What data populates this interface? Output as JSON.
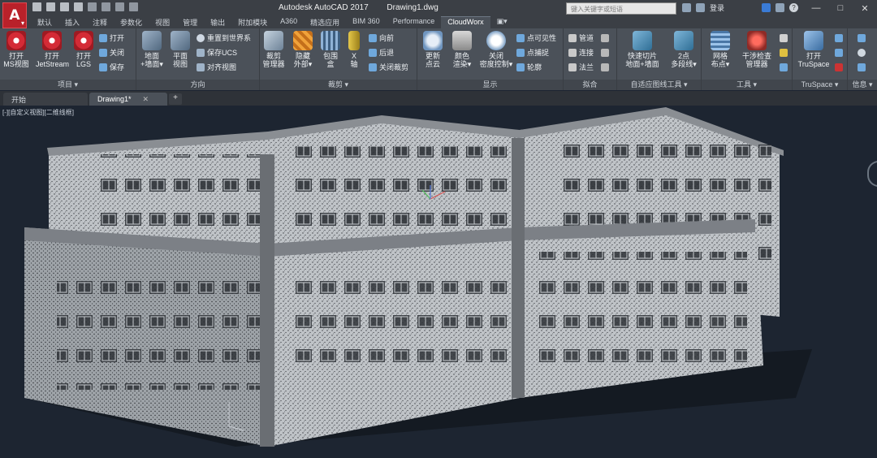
{
  "app": {
    "logo": "A",
    "logo_sub": "▾",
    "title": "Autodesk AutoCAD 2017",
    "file": "Drawing1.dwg"
  },
  "search": {
    "placeholder": "键入关键字或短语"
  },
  "user": {
    "login": "登录",
    "help": "?"
  },
  "window_controls": {
    "minimize": "—",
    "maximize": "□",
    "close": "✕"
  },
  "ribbon_tabs": [
    "默认",
    "插入",
    "注释",
    "参数化",
    "视图",
    "管理",
    "输出",
    "附加模块",
    "A360",
    "精选应用",
    "BIM 360",
    "Performance",
    "CloudWorx",
    "▣▾"
  ],
  "active_tab": "CloudWorx",
  "panels": {
    "project": {
      "title": "项目 ▾",
      "buttons": [
        "打开\nMS视图",
        "打开\nJetStream",
        "打开\nLGS"
      ],
      "small": [
        "打开",
        "关闭",
        "保存"
      ]
    },
    "direction": {
      "title": "方向",
      "buttons": [
        "地面\n+墙面▾",
        "平面\n视图"
      ],
      "small": [
        "重置到世界系",
        "保存UCS",
        "对齐视图"
      ]
    },
    "clip": {
      "title": "裁剪 ▾",
      "buttons": [
        "裁剪\n管理器",
        "隐藏\n外部▾",
        "包围\n盒",
        "X\n轴"
      ],
      "small": [
        "向前",
        "后退",
        "关闭裁剪"
      ]
    },
    "display": {
      "title": "显示",
      "buttons": [
        "更新\n点云",
        "颜色\n渲染▾",
        "关闭\n密度控制▾"
      ],
      "small": [
        "点可见性",
        "点捕捉",
        "轮廓"
      ]
    },
    "fit": {
      "title": "拟合",
      "small": [
        "管道",
        "连接",
        "法兰"
      ]
    },
    "auto": {
      "title": "自适应图线工具 ▾",
      "buttons": [
        "快速切片\n地面+墙面",
        "2点\n多段线▾"
      ]
    },
    "tools": {
      "title": "工具 ▾",
      "buttons": [
        "网格\n布点▾",
        "干涉检查\n管理器"
      ]
    },
    "truspace": {
      "title": "TruSpace ▾",
      "buttons": [
        "打开\nTruSpace"
      ]
    },
    "info": {
      "title": "信息 ▾"
    }
  },
  "doc_tabs": [
    {
      "label": "开始",
      "active": false
    },
    {
      "label": "Drawing1*",
      "active": true,
      "close": "✕"
    }
  ],
  "new_tab": "+",
  "viewport": {
    "label": "[-][自定义视图][二维线框]"
  },
  "colors": {
    "accent": "#b9212a",
    "viewport_bg": "#1d2531",
    "ribbon_bg": "#4b5159",
    "titlebar": "#3b3f45"
  }
}
